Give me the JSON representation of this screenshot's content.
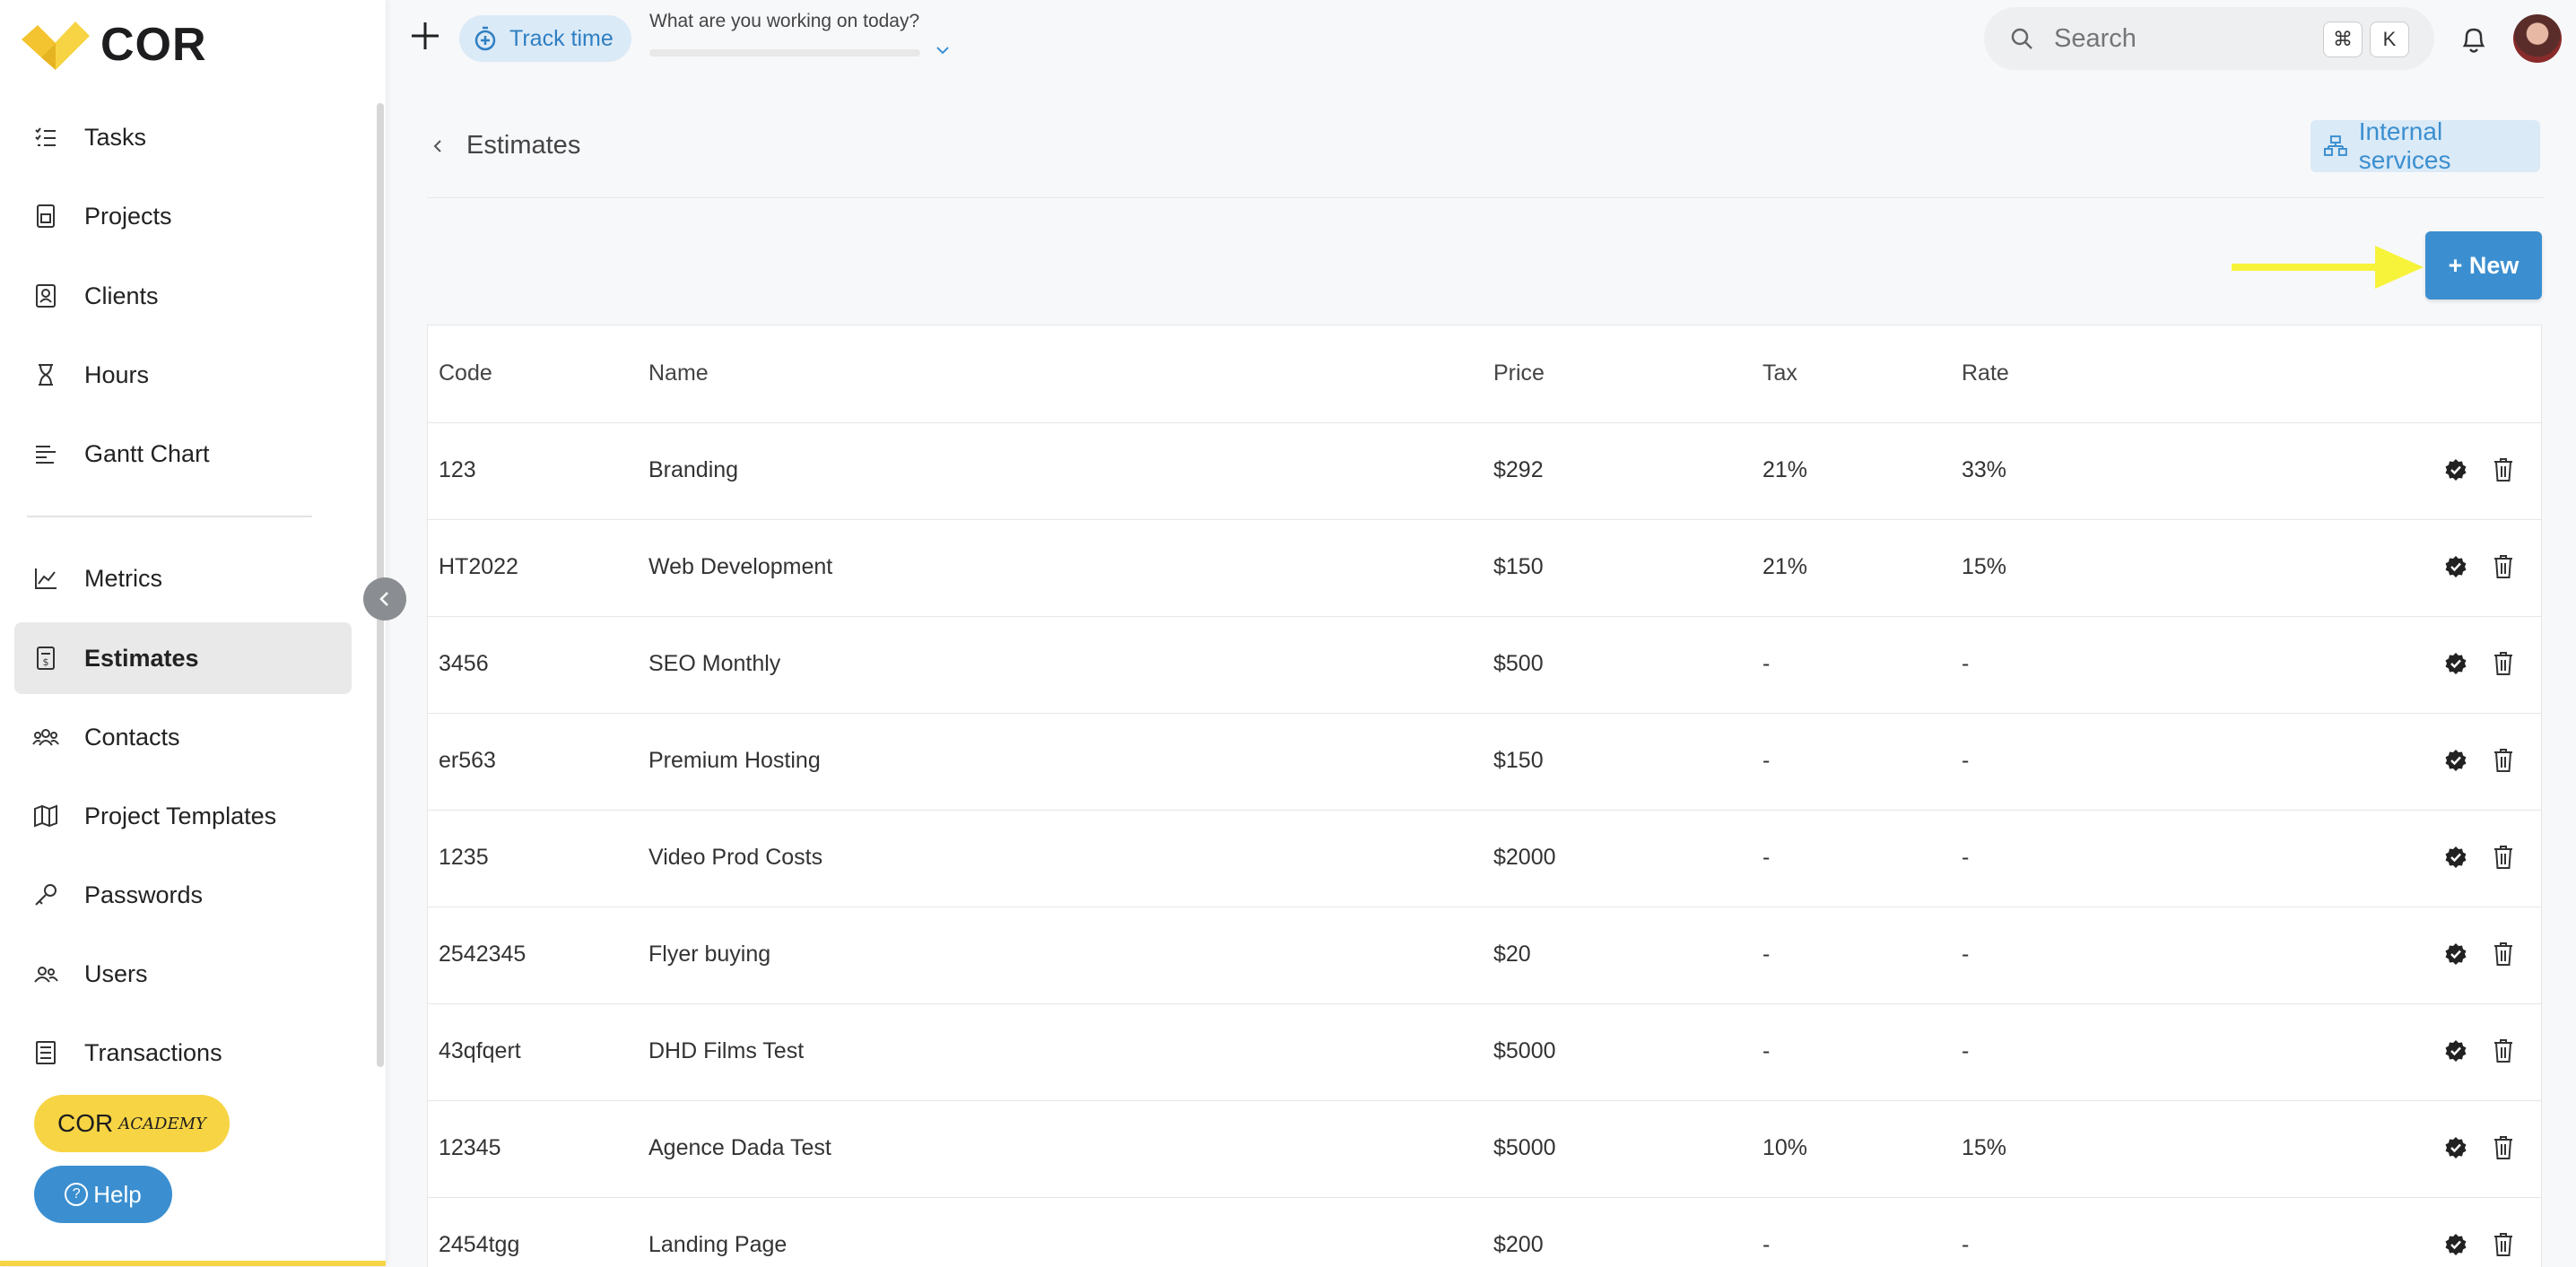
{
  "brand": {
    "name": "COR"
  },
  "sidebar": {
    "items": [
      {
        "label": "Tasks",
        "icon": "tasks-icon"
      },
      {
        "label": "Projects",
        "icon": "projects-icon"
      },
      {
        "label": "Clients",
        "icon": "clients-icon"
      },
      {
        "label": "Hours",
        "icon": "hourglass-icon"
      },
      {
        "label": "Gantt Chart",
        "icon": "gantt-icon"
      },
      {
        "label": "Metrics",
        "icon": "metrics-icon"
      },
      {
        "label": "Estimates",
        "icon": "estimates-icon",
        "active": true
      },
      {
        "label": "Contacts",
        "icon": "contacts-icon"
      },
      {
        "label": "Project Templates",
        "icon": "map-icon"
      },
      {
        "label": "Passwords",
        "icon": "key-icon"
      },
      {
        "label": "Users",
        "icon": "users-icon"
      },
      {
        "label": "Transactions",
        "icon": "transactions-icon"
      }
    ],
    "academy_main": "COR",
    "academy_small": "ACADEMY",
    "help_label": "Help"
  },
  "topbar": {
    "track_time_label": "Track time",
    "working_label": "What are you working on today?",
    "search_placeholder": "Search",
    "shortcut_cmd": "⌘",
    "shortcut_key": "K"
  },
  "header": {
    "title": "Estimates",
    "internal_services_label": "Internal services",
    "new_button_label": "+ New"
  },
  "table": {
    "columns": [
      "Code",
      "Name",
      "Price",
      "Tax",
      "Rate"
    ],
    "rows": [
      {
        "code": "123",
        "name": "Branding",
        "price": "$292",
        "tax": "21%",
        "rate": "33%"
      },
      {
        "code": "HT2022",
        "name": "Web Development",
        "price": "$150",
        "tax": "21%",
        "rate": "15%"
      },
      {
        "code": "3456",
        "name": "SEO Monthly",
        "price": "$500",
        "tax": "-",
        "rate": "-"
      },
      {
        "code": "er563",
        "name": "Premium Hosting",
        "price": "$150",
        "tax": "-",
        "rate": "-"
      },
      {
        "code": "1235",
        "name": "Video Prod Costs",
        "price": "$2000",
        "tax": "-",
        "rate": "-"
      },
      {
        "code": "2542345",
        "name": "Flyer buying",
        "price": "$20",
        "tax": "-",
        "rate": "-"
      },
      {
        "code": "43qfqert",
        "name": "DHD Films Test",
        "price": "$5000",
        "tax": "-",
        "rate": "-"
      },
      {
        "code": "12345",
        "name": "Agence Dada Test",
        "price": "$5000",
        "tax": "10%",
        "rate": "15%"
      },
      {
        "code": "2454tgg",
        "name": "Landing Page",
        "price": "$200",
        "tax": "-",
        "rate": "-"
      }
    ]
  },
  "colors": {
    "accent": "#3b8fd0",
    "accent_light": "#dbeaf7",
    "brand_yellow": "#f7d443",
    "annotation_arrow": "#f7f33a"
  }
}
